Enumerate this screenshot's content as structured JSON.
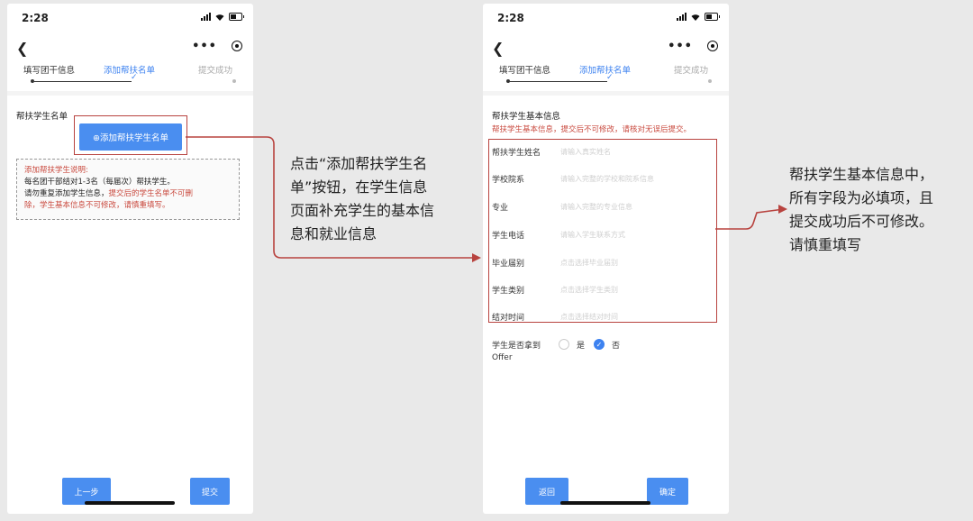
{
  "left_phone": {
    "status_time": "2:28",
    "steps": [
      "填写团干信息",
      "添加帮扶名单",
      "提交成功"
    ],
    "section_title": "帮扶学生名单",
    "add_button_label": "⊕添加帮扶学生名单",
    "notice": {
      "title": "添加帮扶学生说明:",
      "line1": "每名团干部结对1-3名（每届次）帮扶学生。",
      "line2_start": "请勿重复添加学生信息，",
      "line2_red": "提交后的学生名单不可删",
      "line3_red": "除，学生基本信息不可修改，请慎重填写。"
    },
    "prev_button": "上一步",
    "submit_button": "提交"
  },
  "right_phone": {
    "status_time": "2:28",
    "steps": [
      "填写团干信息",
      "添加帮扶名单",
      "提交成功"
    ],
    "section_title": "帮扶学生基本信息",
    "warning": "帮扶学生基本信息，提交后不可修改，请核对无误后提交。",
    "fields": [
      {
        "label": "帮扶学生姓名",
        "placeholder": "请输入真实姓名"
      },
      {
        "label": "学校院系",
        "placeholder": "请输入完整的学校和院系信息"
      },
      {
        "label": "专业",
        "placeholder": "请输入完整的专业信息"
      },
      {
        "label": "学生电话",
        "placeholder": "请输入学生联系方式"
      },
      {
        "label": "毕业届别",
        "placeholder": "点击选择毕业届别"
      },
      {
        "label": "学生类别",
        "placeholder": "点击选择学生类别"
      },
      {
        "label": "结对时间",
        "placeholder": "点击选择结对时间"
      }
    ],
    "offer_label_line1": "学生是否拿到",
    "offer_label_line2": "Offer",
    "offer_yes": "是",
    "offer_no": "否",
    "back_button": "返回",
    "confirm_button": "确定"
  },
  "annotations": {
    "middle": [
      "点击“添加帮扶学生名",
      "单”按钮，在学生信息",
      "页面补充学生的基本信",
      "息和就业信息"
    ],
    "right": [
      "帮扶学生基本信息中，",
      "所有字段为必填项，且",
      "提交成功后不可修改。",
      "请慎重填写"
    ]
  },
  "colors": {
    "accent": "#4a8ef0",
    "highlight_red": "#b8433f",
    "warning_text": "#c94a3f"
  }
}
